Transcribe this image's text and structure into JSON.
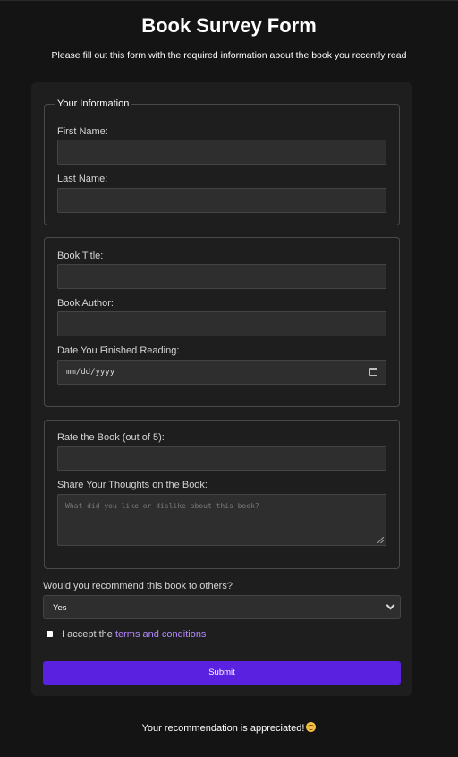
{
  "header": {
    "title": "Book Survey Form",
    "subtitle": "Please fill out this form with the required information about the book you recently read"
  },
  "personal": {
    "legend": "Your Information",
    "first_name_label": "First Name:",
    "first_name_value": "",
    "last_name_label": "Last Name:",
    "last_name_value": ""
  },
  "book": {
    "title_label": "Book Title:",
    "title_value": "",
    "author_label": "Book Author:",
    "author_value": "",
    "date_label": "Date You Finished Reading:",
    "date_placeholder": "mm/dd/yyyy",
    "calendar_icon": "calendar-icon"
  },
  "review": {
    "rating_label": "Rate the Book (out of 5):",
    "rating_value": "",
    "thoughts_label": "Share Your Thoughts on the Book:",
    "thoughts_placeholder": "What did you like or dislike about this book?"
  },
  "recommend": {
    "question": "Would you recommend this book to others?",
    "selected": "Yes",
    "chevron_icon": "chevron-down-icon"
  },
  "terms": {
    "checked": false,
    "prefix": "I accept the",
    "link_text": "terms and conditions"
  },
  "submit_label": "Submit",
  "footer": {
    "text": "Your recommendation is appreciated!",
    "emoji_icon": "smiling-face-icon"
  },
  "colors": {
    "background": "#141414",
    "card": "#1e1e1e",
    "accent": "#5b21e0",
    "link": "#b389ff"
  }
}
